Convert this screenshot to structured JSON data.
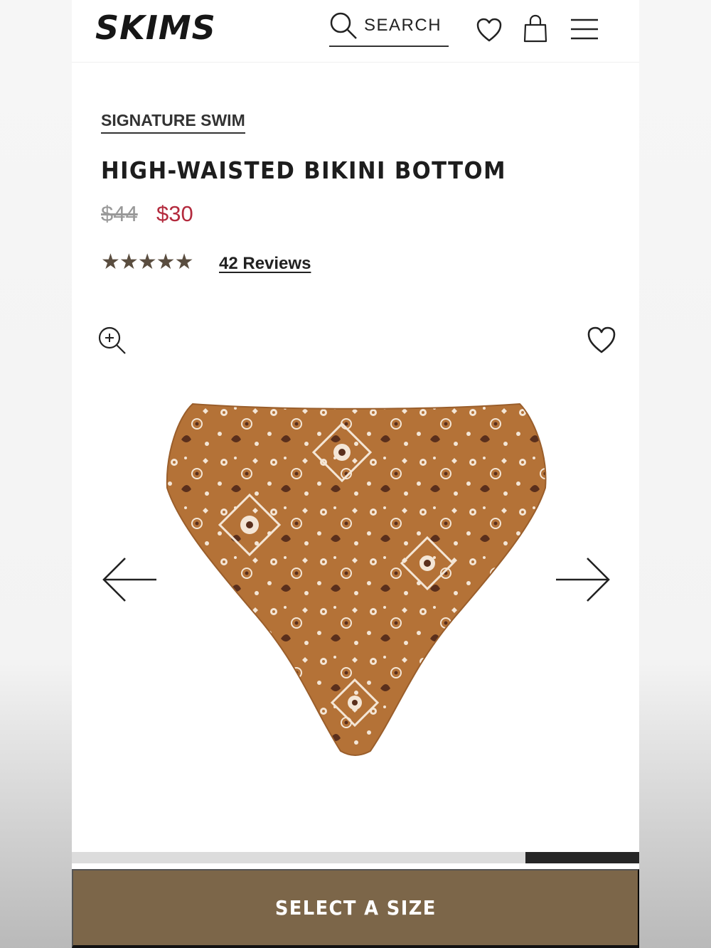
{
  "header": {
    "logo": "SKIMS",
    "search_label": "SEARCH",
    "icons": [
      "search-icon",
      "heart-icon",
      "shopping-bag-icon",
      "menu-icon"
    ]
  },
  "product": {
    "breadcrumb": "SIGNATURE SWIM",
    "title": "HIGH-WAISTED BIKINI BOTTOM",
    "price_original": "$44",
    "price_sale": "$30",
    "rating": "★★★★★",
    "rating_value": 5,
    "reviews_label": "42 Reviews"
  },
  "gallery": {
    "icons": [
      "zoom-in-icon",
      "heart-icon",
      "arrow-left-icon",
      "arrow-right-icon"
    ],
    "progress": 0.2
  },
  "cta": {
    "label": "SELECT A SIZE"
  },
  "colors": {
    "sale_price": "#b32a3d",
    "stars": "#5a4d3f",
    "cta_background": "#7c6649",
    "product_tan": "#b47237"
  }
}
